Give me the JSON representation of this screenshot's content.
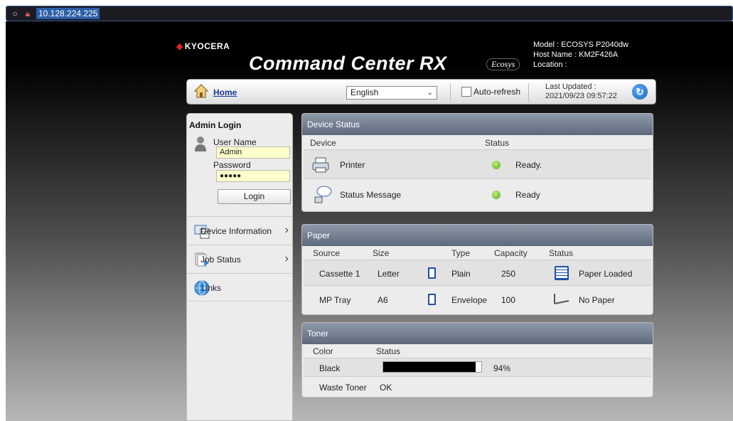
{
  "browser": {
    "url": "10.128.224.225"
  },
  "header": {
    "brand": "KYOCERA",
    "title": "Command Center RX",
    "ecosys": "Ecosys",
    "model": "Model : ECOSYS P2040dw",
    "host": "Host Name : KM2F426A",
    "location": "Location :"
  },
  "navbar": {
    "home": "Home",
    "language": "English",
    "auto_refresh": "Auto-refresh",
    "last_updated_label": "Last Updated :",
    "last_updated_value": "2021/09/23 09:57:22"
  },
  "sidebar": {
    "admin_login": "Admin Login",
    "username_label": "User Name",
    "username_value": "Admin",
    "password_label": "Password",
    "password_value": "●●●●●",
    "login_button": "Login",
    "items": [
      {
        "label": "Device Information",
        "icon": "device-info-icon"
      },
      {
        "label": "Job Status",
        "icon": "job-status-icon"
      },
      {
        "label": "Links",
        "icon": "globe-icon"
      }
    ]
  },
  "device_status": {
    "title": "Device Status",
    "col_device": "Device",
    "col_status": "Status",
    "rows": [
      {
        "device": "Printer",
        "status": "Ready."
      },
      {
        "device": "Status Message",
        "status": "Ready"
      }
    ]
  },
  "paper": {
    "title": "Paper",
    "columns": [
      "Source",
      "Size",
      "Type",
      "Capacity",
      "Status"
    ],
    "rows": [
      {
        "source": "Cassette 1",
        "size": "Letter",
        "type": "Plain",
        "capacity": "250",
        "status": "Paper Loaded"
      },
      {
        "source": "MP Tray",
        "size": "A6",
        "type": "Envelope",
        "capacity": "100",
        "status": "No Paper"
      }
    ]
  },
  "toner": {
    "title": "Toner",
    "col_color": "Color",
    "col_status": "Status",
    "black_label": "Black",
    "black_percent": "94%",
    "black_level": 0.94,
    "waste_label": "Waste Toner",
    "waste_status": "OK"
  }
}
